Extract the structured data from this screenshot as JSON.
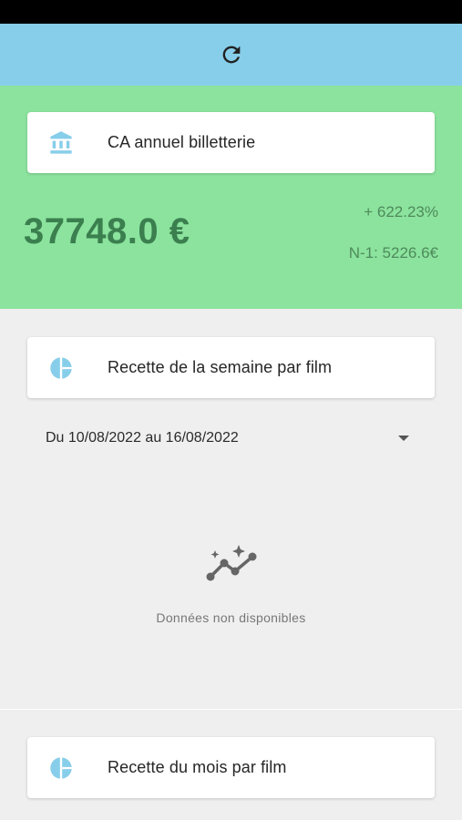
{
  "header": {
    "refresh_icon": "refresh-icon"
  },
  "ca_card": {
    "icon": "bank-icon",
    "label": "CA annuel billetterie"
  },
  "ca_summary": {
    "value": "37748.0 €",
    "percent": "+ 622.23%",
    "previous": "N-1: 5226.6€"
  },
  "weekly_card": {
    "icon": "pie-chart-icon",
    "label": "Recette de la semaine par film"
  },
  "weekly_filter": {
    "selected": "Du 10/08/2022 au 16/08/2022",
    "dropdown_icon": "chevron-down-icon"
  },
  "empty_state": {
    "icon": "insights-icon",
    "text": "Données non disponibles"
  },
  "monthly_card": {
    "icon": "pie-chart-icon",
    "label": "Recette du mois par film"
  },
  "colors": {
    "app_bar": "#87ceea",
    "green_panel": "#8be39d",
    "accent_icon": "#87ceea",
    "value_text": "#3b7f4f"
  }
}
